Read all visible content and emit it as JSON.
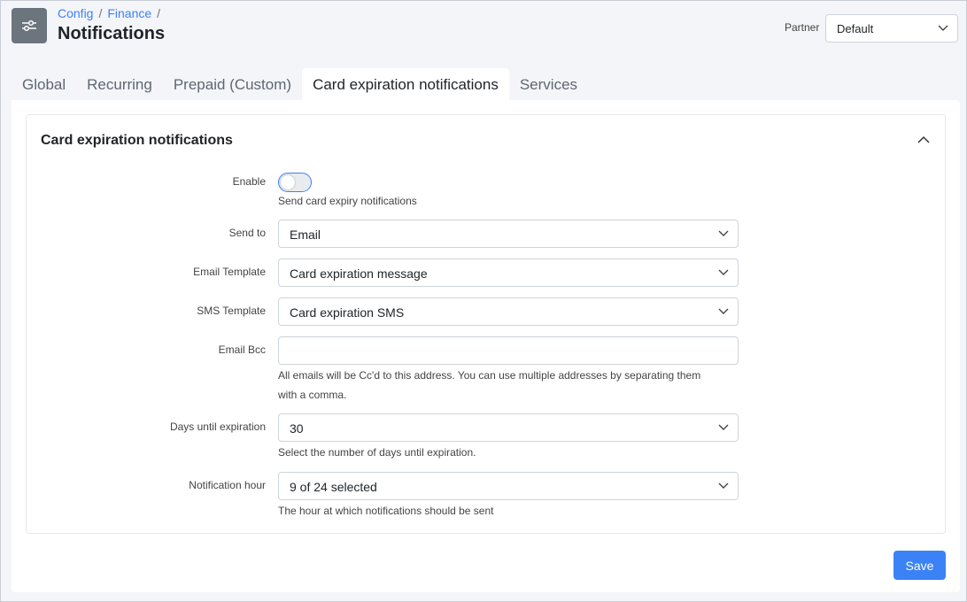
{
  "breadcrumb": {
    "items": [
      "Config",
      "Finance"
    ],
    "separator": "/"
  },
  "page": {
    "title": "Notifications",
    "icon": "sliders-icon"
  },
  "partner": {
    "label": "Partner",
    "value": "Default"
  },
  "tabs": [
    {
      "label": "Global",
      "active": false
    },
    {
      "label": "Recurring",
      "active": false
    },
    {
      "label": "Prepaid (Custom)",
      "active": false
    },
    {
      "label": "Card expiration notifications",
      "active": true
    },
    {
      "label": "Services",
      "active": false
    }
  ],
  "card": {
    "title": "Card expiration notifications",
    "enable": {
      "label": "Enable",
      "checked": false,
      "help": "Send card expiry notifications"
    },
    "send_to": {
      "label": "Send to",
      "value": "Email"
    },
    "email_template": {
      "label": "Email Template",
      "value": "Card expiration message"
    },
    "sms_template": {
      "label": "SMS Template",
      "value": "Card expiration SMS"
    },
    "email_bcc": {
      "label": "Email Bcc",
      "value": "",
      "help_line1": "All emails will be Cc'd to this address. You can use multiple addresses by separating them",
      "help_line2": "with a comma."
    },
    "days_until_expiration": {
      "label": "Days until expiration",
      "value": "30",
      "help": "Select the number of days until expiration."
    },
    "notification_hour": {
      "label": "Notification hour",
      "value": "9 of 24 selected",
      "help": "The hour at which notifications should be sent"
    }
  },
  "actions": {
    "save_label": "Save"
  },
  "colors": {
    "accent": "#3b82f6",
    "icon_bg": "#6c757d",
    "page_bg": "#f4f5f9"
  }
}
